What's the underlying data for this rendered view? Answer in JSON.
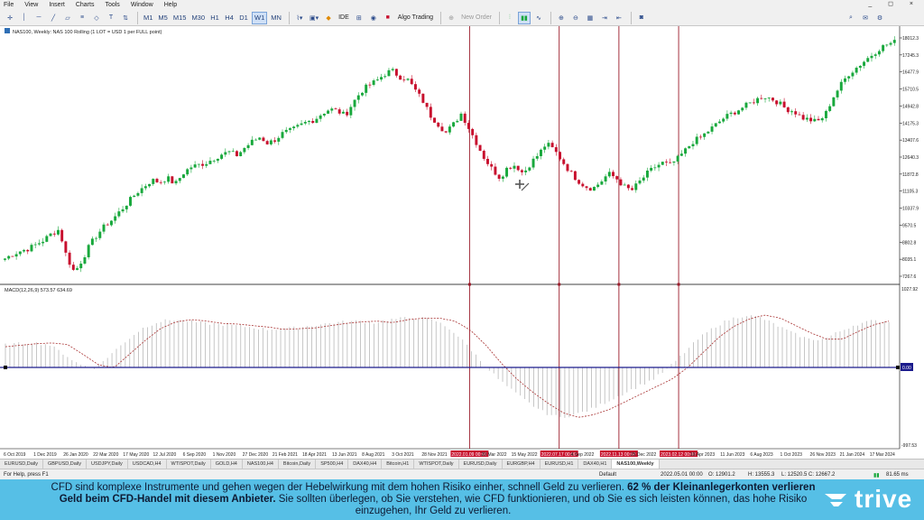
{
  "menu": [
    "File",
    "View",
    "Insert",
    "Charts",
    "Tools",
    "Window",
    "Help"
  ],
  "window_controls": "_ ◻ ×",
  "toolbar": {
    "timeframes": [
      "M1",
      "M5",
      "M15",
      "M30",
      "H1",
      "H4",
      "D1",
      "W1",
      "MN"
    ],
    "active_timeframe": "W1",
    "ide_label": "IDE",
    "algo_label": "Algo Trading",
    "new_order_label": "New Order"
  },
  "chart": {
    "info_label": "NAS100, Weekly: NAS 100 Rolling (1 LOT = USD 1 per FULL point)",
    "macd_label": "MACD(12,26,9) 573.57 634.69",
    "macd_zero_label": "0.00"
  },
  "chart_data": {
    "type": "candlestick",
    "x_labels": [
      "6 Oct 2019",
      "1 Dec 2019",
      "26 Jan 2020",
      "22 Mar 2020",
      "17 May 2020",
      "12 Jul 2020",
      "6 Sep 2020",
      "1 Nov 2020",
      "27 Dec 2020",
      "21 Feb 2021",
      "18 Apr 2021",
      "13 Jun 2021",
      "8 Aug 2021",
      "3 Oct 2021",
      "28 Nov 2021",
      "2022.01.09 00:00",
      "20 Mar 2022",
      "15 May 2022",
      "2022.07.17 00:00",
      "4 Sep 2022",
      "2022.11.13 00:00",
      "25 Dec 2022",
      "2023.02.12 00:00",
      "16 Apr 2023",
      "11 Jun 2023",
      "6 Aug 2023",
      "1 Oct 2023",
      "26 Nov 2023",
      "21 Jan 2024",
      "17 Mar 2024"
    ],
    "price_axis": [
      "18012.3",
      "17245.3",
      "16477.9",
      "15710.5",
      "14942.8",
      "14175.3",
      "13407.6",
      "12640.3",
      "11872.8",
      "11105.3",
      "10337.9",
      "9570.5",
      "8802.8",
      "8035.1",
      "7267.6"
    ],
    "macd_axis": [
      "1027.92",
      "-997.53"
    ],
    "price_range": [
      7000,
      18500
    ],
    "macd_range": [
      -1050,
      1060
    ],
    "price_path": [
      7950,
      8150,
      8300,
      8400,
      8600,
      8800,
      9100,
      9300,
      8000,
      7300,
      7900,
      8600,
      9100,
      9500,
      9800,
      10200,
      10600,
      11000,
      11300,
      11600,
      11500,
      11700,
      11400,
      11900,
      12200,
      12300,
      12400,
      12600,
      12800,
      12900,
      12750,
      13100,
      13400,
      13600,
      13300,
      13500,
      13800,
      13900,
      14100,
      14300,
      14400,
      14700,
      14900,
      14800,
      14600,
      15200,
      15700,
      16000,
      16200,
      16500,
      16700,
      16400,
      16300,
      15800,
      15300,
      14600,
      14200,
      13800,
      14200,
      14700,
      14000,
      13300,
      12600,
      12100,
      11700,
      12200,
      12300,
      11900,
      12400,
      12800,
      13300,
      13000,
      12500,
      12000,
      11600,
      11300,
      11200,
      11500,
      11900,
      11700,
      11300,
      11100,
      11500,
      11900,
      12200,
      12400,
      12300,
      12600,
      13000,
      13400,
      13600,
      13900,
      14200,
      14500,
      14700,
      14900,
      15100,
      15300,
      15500,
      15400,
      15200,
      14900,
      14800,
      14500,
      14400,
      14300,
      14600,
      15400,
      16000,
      16500,
      16800,
      17100,
      17400,
      17700,
      17900,
      18012
    ],
    "macd_signal_path": [
      280,
      300,
      320,
      330,
      310,
      180,
      40,
      0,
      180,
      360,
      520,
      610,
      640,
      620,
      590,
      580,
      560,
      540,
      510,
      520,
      530,
      560,
      590,
      610,
      620,
      600,
      640,
      660,
      660,
      620,
      500,
      300,
      60,
      -150,
      -320,
      -470,
      -600,
      -660,
      -620,
      -550,
      -450,
      -350,
      -250,
      -150,
      0,
      200,
      400,
      550,
      650,
      700,
      660,
      560,
      460,
      380,
      380,
      480,
      570,
      620
    ],
    "date_markers": [
      "2022.01.09 00:00",
      "2022.07.17 00:00",
      "2022.11.13 00:00",
      "2023.02.12 00:00"
    ]
  },
  "tabs": [
    "EURUSD,Daily",
    "GBPUSD,Daily",
    "USDJPY,Daily",
    "USDCAD,H4",
    "WTISPOT,Daily",
    "GOLD,H4",
    "NAS100,H4",
    "Bitcoin,Daily",
    "SP500,H4",
    "DAX40,H4",
    "Bitcoin,H1",
    "WTISPOT,Daily",
    "EURUSD,Daily",
    "EURGBP,H4",
    "EURUSD,H1",
    "DAX40,H1",
    "NAS100,Weekly"
  ],
  "active_tab": "NAS100,Weekly",
  "status": {
    "help": "For Help, press F1",
    "profile": "Default",
    "date": "2022.05.01 00:00",
    "open": "O: 12901.2",
    "high": "H: 13555.3",
    "low": "L: 12520.5",
    "close": "C: 12667.2",
    "traffic": "81.65 ms"
  },
  "disclaimer": {
    "part1": "CFD sind komplexe Instrumente und gehen wegen der Hebelwirkung mit dem hohen Risiko einher, schnell Geld zu verlieren.",
    "bold": "62 % der Kleinanlegerkonten verlieren Geld beim CFD-Handel mit diesem Anbieter.",
    "part2": "Sie sollten überlegen, ob Sie verstehen, wie CFD funktionieren, und ob Sie es sich leisten können, das hohe Risiko einzugehen, Ihr Geld zu verlieren."
  },
  "brand": {
    "name": "trive",
    "bull_color": "#18a83c",
    "bear_color": "#c8102e",
    "disclaimer_bg": "#56bfe6"
  }
}
